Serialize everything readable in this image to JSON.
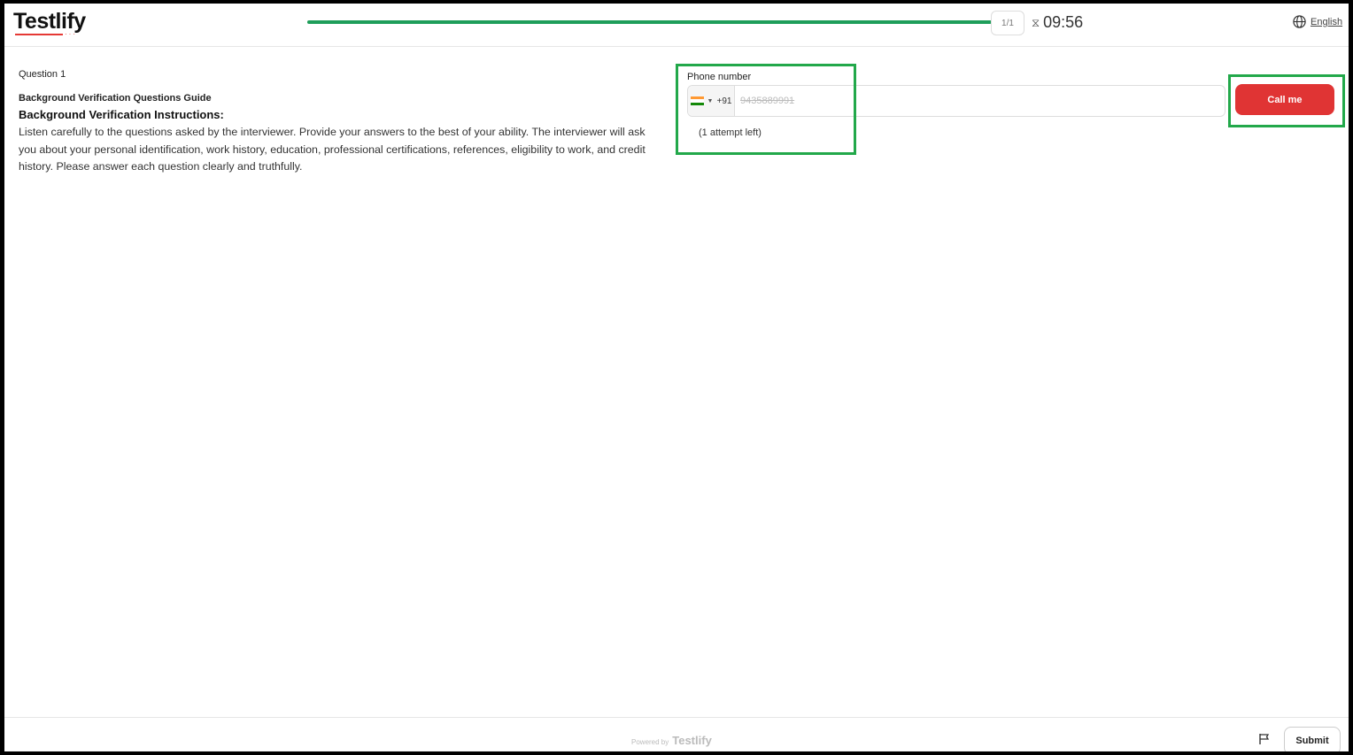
{
  "header": {
    "logo": "Testlify",
    "progress_percent": 100,
    "question_counter": "1/1",
    "timer": "09:56",
    "language": "English"
  },
  "question": {
    "label": "Question 1",
    "guide_title": "Background Verification Questions Guide",
    "instructions_title": "Background Verification Instructions:",
    "instructions_body": "Listen carefully to the questions asked by the interviewer. Provide your answers to the best of your ability. The interviewer will ask you about your personal identification, work history, education, professional certifications, references, eligibility to work, and credit history. Please answer each question clearly and truthfully."
  },
  "phone": {
    "label": "Phone number",
    "country_code": "+91",
    "country_flag": "india-flag-icon",
    "number": "9435889991",
    "attempts": "(1  attempt left)"
  },
  "call_button": "Call me",
  "footer": {
    "powered_by": "Powered by",
    "powered_logo": "Testlify",
    "submit": "Submit"
  },
  "colors": {
    "progress": "#1e9e5a",
    "call_button": "#e03434",
    "highlight": "#22a84a"
  }
}
